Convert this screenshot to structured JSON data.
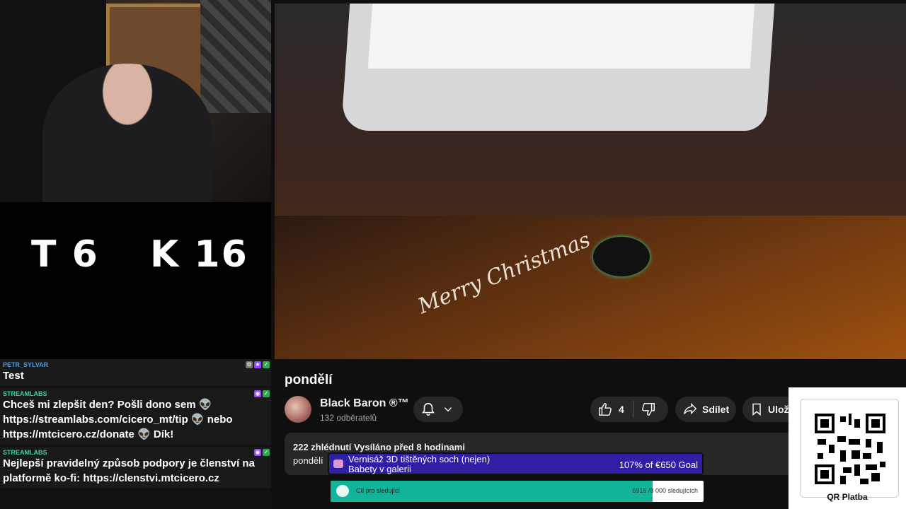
{
  "score": {
    "t_label": "T 6",
    "k_label": "K 16"
  },
  "chat": [
    {
      "user": "PETR_SYLVAR",
      "user_color": "#4a9ee6",
      "lines": [
        "Test"
      ]
    },
    {
      "user": "STREAMLABS",
      "user_color": "#37d39f",
      "lines": [
        "Chceš mi zlepšit den? Pošli dono sem 👽",
        "https://streamlabs.com/cicero_mt/tip 👽 nebo",
        "https://mtcicero.cz/donate 👽 Dík!"
      ]
    },
    {
      "user": "STREAMLABS",
      "user_color": "#37d39f",
      "lines": [
        "Nejlepší pravidelný způsob podpory je členství na",
        "platformě ko-fi: https://clenstvi.mtcicero.cz"
      ]
    }
  ],
  "video": {
    "xmas_text": "Merry Christmas"
  },
  "page": {
    "title": "pondělí",
    "channel": "Black Baron ®™",
    "subscribers": "132 odběratelů",
    "like_count": "4",
    "share_label": "Sdílet",
    "save_label": "Ulož",
    "views": "222 zhlédnutí  Vysíláno před 8 hodinami",
    "description": "pondělí"
  },
  "goal": {
    "text_line1": "Vernisáž 3D tištěných soch (nejen)",
    "text_line2": "Babety v galerii",
    "value": "107% of €650 Goal",
    "color": "#2e1fa3"
  },
  "follower_goal": {
    "label": "Cíl pro sledující",
    "value": "6915 /8 000 sledujících",
    "progress": 0.864,
    "color": "#12b59a"
  },
  "qr": {
    "label": "QR Platba"
  }
}
